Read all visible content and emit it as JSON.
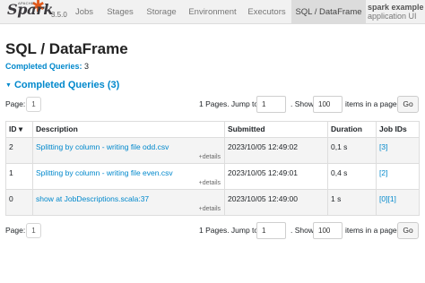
{
  "brand": {
    "apache": "APACHE",
    "name": "Spark",
    "version": "3.5.0"
  },
  "nav": {
    "tabs": [
      {
        "label": "Jobs"
      },
      {
        "label": "Stages"
      },
      {
        "label": "Storage"
      },
      {
        "label": "Environment"
      },
      {
        "label": "Executors"
      },
      {
        "label": "SQL / DataFrame"
      }
    ],
    "app_name": "spark example",
    "app_sub": "application UI"
  },
  "page": {
    "title": "SQL / DataFrame",
    "summary_label": "Completed Queries:",
    "summary_value": "3",
    "section_title": "Completed Queries (3)"
  },
  "pager": {
    "page_label": "Page:",
    "current_page": "1",
    "pages_text": "1 Pages. Jump to",
    "jump_value": "1",
    "show_text": ". Show",
    "page_size": "100",
    "items_text": "items in a page.",
    "go_label": "Go"
  },
  "table": {
    "headers": {
      "id": "ID ▾",
      "description": "Description",
      "submitted": "Submitted",
      "duration": "Duration",
      "job_ids": "Job IDs"
    },
    "details_label": "+details",
    "rows": [
      {
        "id": "2",
        "description": "Splitting by column - writing file odd.csv",
        "submitted": "2023/10/05 12:49:02",
        "duration": "0,1 s",
        "job_ids": [
          "[3]"
        ]
      },
      {
        "id": "1",
        "description": "Splitting by column - writing file even.csv",
        "submitted": "2023/10/05 12:49:01",
        "duration": "0,4 s",
        "job_ids": [
          "[2]"
        ]
      },
      {
        "id": "0",
        "description": "show at JobDescriptions.scala:37",
        "submitted": "2023/10/05 12:49:00",
        "duration": "1 s",
        "job_ids": [
          "[0]",
          "[1]"
        ]
      }
    ]
  },
  "colors": {
    "link": "#0088cc",
    "spark_orange": "#e25a1c",
    "navbar_bg": "#f1f1f1",
    "active_tab_bg": "#dcdcdc"
  }
}
